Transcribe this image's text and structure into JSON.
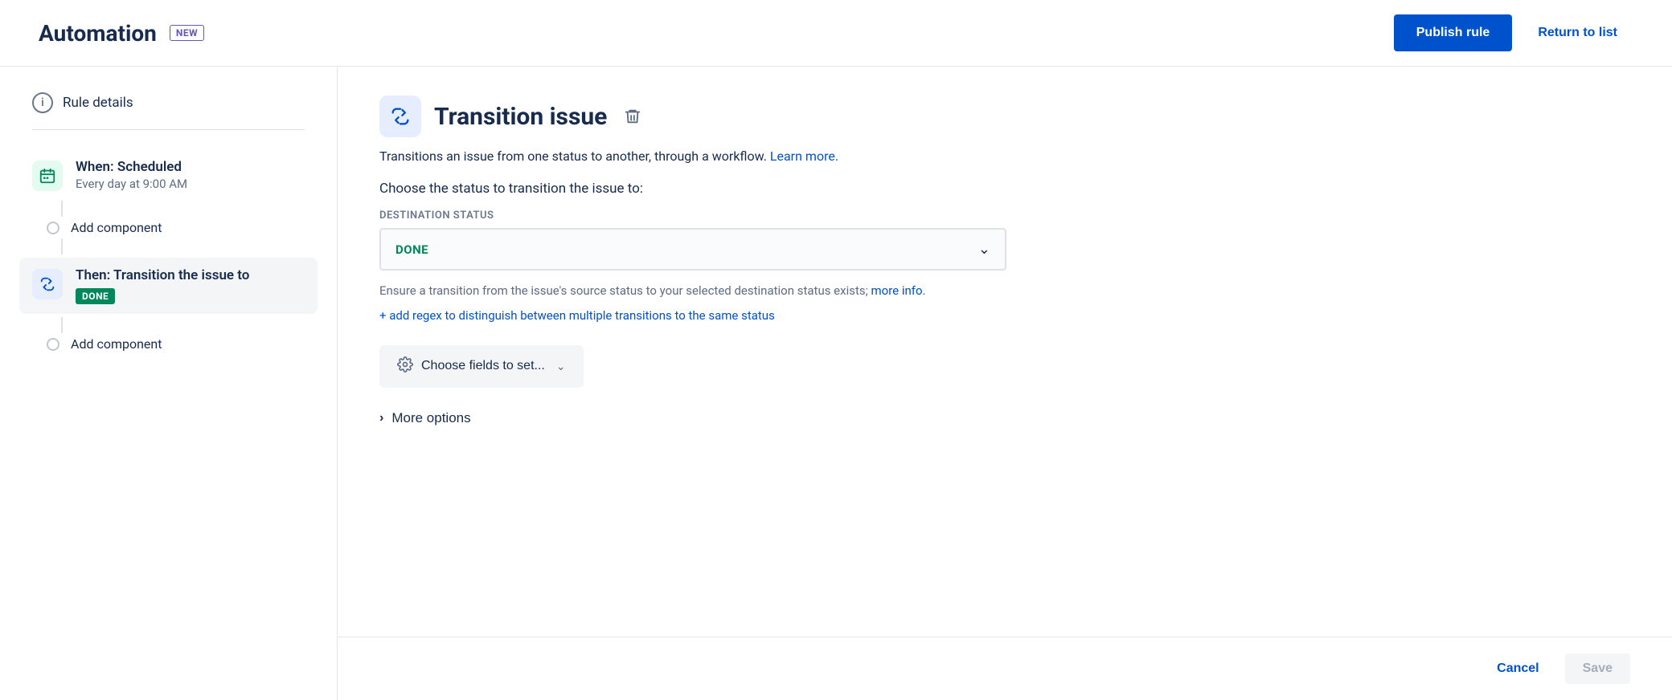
{
  "header": {
    "title": "Automation",
    "badge": "NEW",
    "publish_button": "Publish rule",
    "return_button": "Return to list"
  },
  "sidebar": {
    "rule_details_label": "Rule details",
    "when_item": {
      "title": "When: Scheduled",
      "subtitle": "Every day at 9:00 AM"
    },
    "add_component_1": "Add component",
    "then_item": {
      "title": "Then: Transition the issue to",
      "badge": "DONE"
    },
    "add_component_2": "Add component"
  },
  "panel": {
    "title": "Transition issue",
    "description_text": "Transitions an issue from one status to another, through a workflow.",
    "learn_more": "Learn more.",
    "choose_status_text": "Choose the status to transition the issue to:",
    "destination_label": "Destination status",
    "status_value": "DONE",
    "ensure_text": "Ensure a transition from the issue's source status to your selected destination status exists;",
    "more_info_link": "more info.",
    "add_regex_link": "+ add regex to distinguish between multiple transitions to the same status",
    "choose_fields_button": "Choose fields to set...",
    "more_options_button": "More options"
  },
  "footer": {
    "cancel_button": "Cancel",
    "save_button": "Save"
  }
}
